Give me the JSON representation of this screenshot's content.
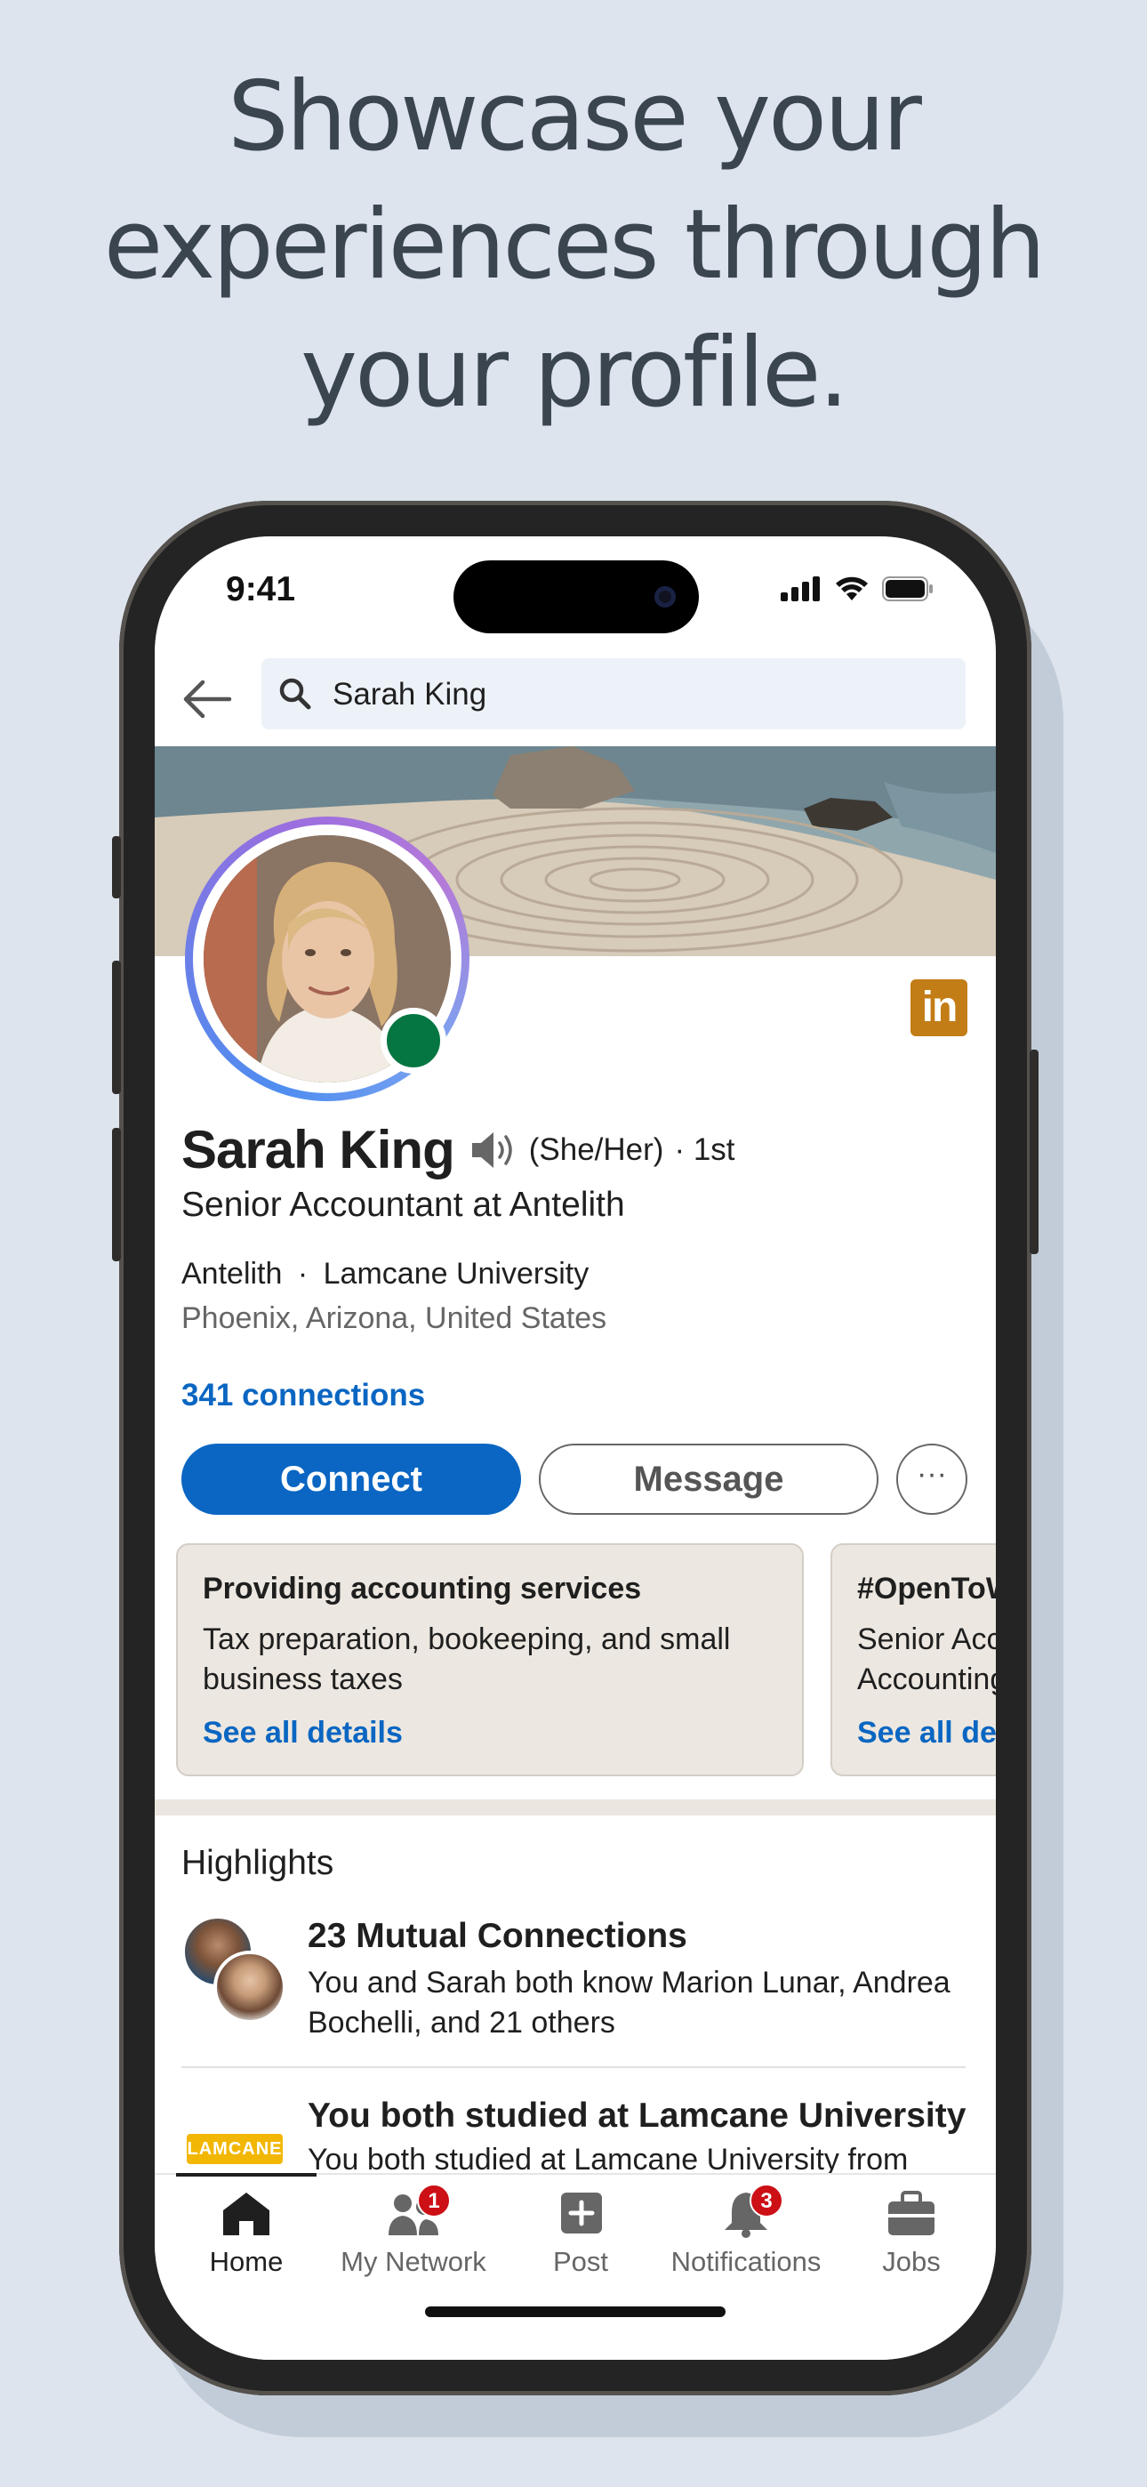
{
  "marketing": {
    "headline_line1": "Showcase your",
    "headline_line2": "experiences through",
    "headline_line3": "your profile."
  },
  "status_bar": {
    "time": "9:41"
  },
  "search": {
    "query": "Sarah King"
  },
  "profile": {
    "name": "Sarah King",
    "pronouns": "(She/Her)",
    "degree": "· 1st",
    "headline": "Senior Accountant at Antelith",
    "company": "Antelith",
    "separator": "·",
    "school": "Lamcane University",
    "location": "Phoenix, Arizona, United States",
    "connections": "341 connections",
    "badge_text": "in"
  },
  "actions": {
    "connect_label": "Connect",
    "message_label": "Message",
    "more_label": "···"
  },
  "cards": [
    {
      "title": "Providing accounting services",
      "body": "Tax preparation, bookeeping, and small business taxes",
      "link": "See all details"
    },
    {
      "title": "#OpenToWork",
      "body": "Senior Accountant, Accounting Manager",
      "link": "See all details"
    }
  ],
  "highlights": {
    "title": "Highlights",
    "items": [
      {
        "title": "23 Mutual Connections",
        "body": "You and Sarah both know Marion Lunar, Andrea Bochelli, and 21 others"
      },
      {
        "title": "You both studied at Lamcane University",
        "body": "You both studied at Lamcane University from",
        "logo_text": "LAMCANE"
      }
    ]
  },
  "bottom_nav": {
    "items": [
      {
        "label": "Home",
        "icon": "home-icon",
        "active": true
      },
      {
        "label": "My Network",
        "icon": "network-icon",
        "badge": "1"
      },
      {
        "label": "Post",
        "icon": "plus-square-icon"
      },
      {
        "label": "Notifications",
        "icon": "bell-icon",
        "badge": "3"
      },
      {
        "label": "Jobs",
        "icon": "briefcase-icon"
      }
    ]
  },
  "colors": {
    "brand_blue": "#0a66c2",
    "online_green": "#057642",
    "badge_red": "#cc1016",
    "premium_gold": "#c37d16",
    "background": "#dde4ed"
  }
}
